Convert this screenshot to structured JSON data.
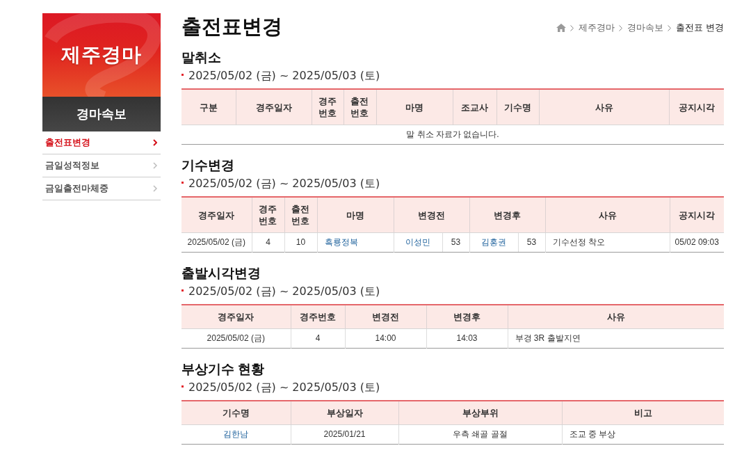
{
  "sidebar": {
    "logo_text": "제주경마",
    "section_title": "경마속보",
    "items": [
      {
        "label": "출전표변경",
        "selected": true
      },
      {
        "label": "금일성적정보",
        "selected": false
      },
      {
        "label": "금일출전마체중",
        "selected": false
      }
    ]
  },
  "page": {
    "title": "출전표변경",
    "breadcrumb": [
      {
        "label": "제주경마",
        "current": false
      },
      {
        "label": "경마속보",
        "current": false
      },
      {
        "label": "출전표 변경",
        "current": true
      }
    ]
  },
  "sections": [
    {
      "heading": "말취소",
      "date_range": "2025/05/02 (금) ~ 2025/05/03 (토)",
      "table": {
        "columns": [
          "구분",
          "경주일자",
          "경주번호",
          "출전번호",
          "마명",
          "조교사",
          "기수명",
          "사유",
          "공지시각"
        ],
        "empty_message": "말 취소 자료가 없습니다."
      }
    },
    {
      "heading": "기수변경",
      "date_range": "2025/05/02 (금) ~ 2025/05/03 (토)",
      "table": {
        "columns": [
          "경주일자",
          "경주번호",
          "출전번호",
          "마명",
          "변경전",
          "변경후",
          "사유",
          "공지시각"
        ],
        "rows": [
          [
            {
              "text": "2025/05/02 (금)",
              "kind": "text"
            },
            {
              "text": "4",
              "kind": "text"
            },
            {
              "text": "10",
              "kind": "text"
            },
            {
              "text": "흑룡정복",
              "kind": "link"
            },
            {
              "text": "이성민",
              "value": "53",
              "kind": "link_value"
            },
            {
              "text": "김홍권",
              "value": "53",
              "kind": "link_value"
            },
            {
              "text": "기수선정 착오",
              "kind": "text"
            },
            {
              "text": "05/02 09:03",
              "kind": "text"
            }
          ]
        ]
      }
    },
    {
      "heading": "출발시각변경",
      "date_range": "2025/05/02 (금) ~ 2025/05/03 (토)",
      "table": {
        "columns": [
          "경주일자",
          "경주번호",
          "변경전",
          "변경후",
          "사유"
        ],
        "rows": [
          [
            {
              "text": "2025/05/02 (금)",
              "kind": "text"
            },
            {
              "text": "4",
              "kind": "text"
            },
            {
              "text": "14:00",
              "kind": "text"
            },
            {
              "text": "14:03",
              "kind": "text"
            },
            {
              "text": "부경 3R 출발지연",
              "kind": "text"
            }
          ]
        ]
      }
    },
    {
      "heading": "부상기수 현황",
      "date_range": "2025/05/02 (금) ~ 2025/05/03 (토)",
      "table": {
        "columns": [
          "기수명",
          "부상일자",
          "부상부위",
          "비고"
        ],
        "rows": [
          [
            {
              "text": "김한남",
              "kind": "link"
            },
            {
              "text": "2025/01/21",
              "kind": "text"
            },
            {
              "text": "우측 쇄골 골절",
              "kind": "text"
            },
            {
              "text": "조교 중 부상",
              "kind": "text"
            }
          ]
        ]
      }
    }
  ]
}
